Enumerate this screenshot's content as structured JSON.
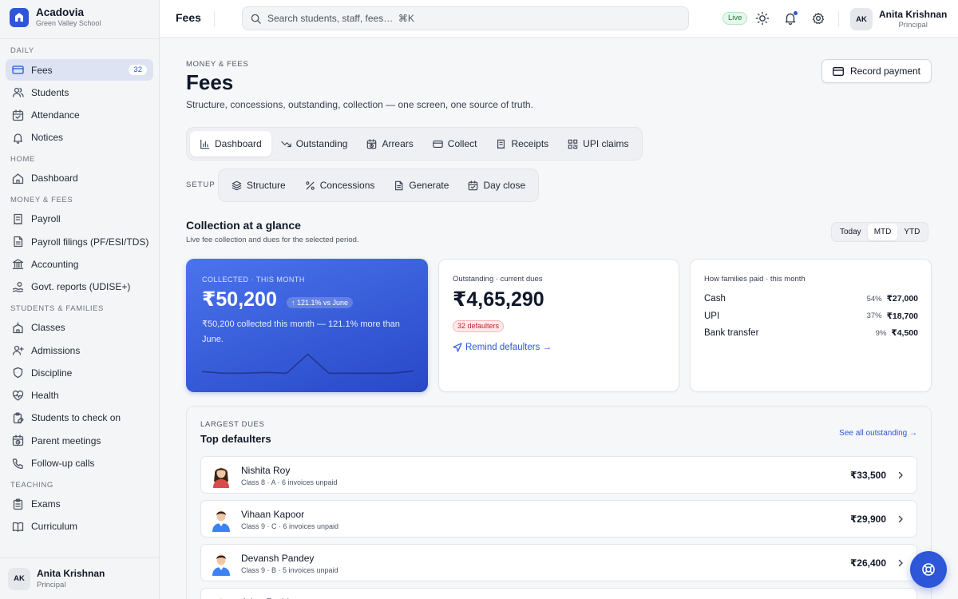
{
  "app": {
    "name": "Acadovia",
    "school": "Green Valley School"
  },
  "sidebar": {
    "sections": [
      {
        "label": "DAILY",
        "items": [
          {
            "label": "Fees",
            "badge": "32",
            "icon": "credit-card-icon",
            "active": true
          },
          {
            "label": "Students",
            "icon": "users-icon"
          },
          {
            "label": "Attendance",
            "icon": "calendar-check-icon"
          },
          {
            "label": "Notices",
            "icon": "bell-icon"
          }
        ]
      },
      {
        "label": "HOME",
        "items": [
          {
            "label": "Dashboard",
            "icon": "home-icon"
          }
        ]
      },
      {
        "label": "MONEY & FEES",
        "items": [
          {
            "label": "Payroll",
            "icon": "receipt-icon"
          },
          {
            "label": "Payroll filings (PF/ESI/TDS)",
            "icon": "file-icon"
          },
          {
            "label": "Accounting",
            "icon": "bank-icon"
          },
          {
            "label": "Govt. reports (UDISE+)",
            "icon": "hand-coins-icon"
          }
        ]
      },
      {
        "label": "STUDENTS & FAMILIES",
        "items": [
          {
            "label": "Classes",
            "icon": "school-icon"
          },
          {
            "label": "Admissions",
            "icon": "user-plus-icon"
          },
          {
            "label": "Discipline",
            "icon": "shield-icon"
          },
          {
            "label": "Health",
            "icon": "heart-pulse-icon"
          },
          {
            "label": "Students to check on",
            "icon": "clipboard-edit-icon"
          },
          {
            "label": "Parent meetings",
            "icon": "calendar-clock-icon"
          },
          {
            "label": "Follow-up calls",
            "icon": "phone-icon"
          }
        ]
      },
      {
        "label": "TEACHING",
        "items": [
          {
            "label": "Exams",
            "icon": "clipboard-list-icon"
          },
          {
            "label": "Curriculum",
            "icon": "book-open-icon"
          }
        ]
      }
    ],
    "user": {
      "initials": "AK",
      "name": "Anita Krishnan",
      "role": "Principal"
    }
  },
  "topbar": {
    "title": "Fees",
    "search_placeholder": "Search students, staff, fees…  ⌘K",
    "live": "Live",
    "user": {
      "initials": "AK",
      "name": "Anita Krishnan",
      "role": "Principal"
    }
  },
  "page": {
    "eyebrow": "MONEY & FEES",
    "title": "Fees",
    "subtitle": "Structure, concessions, outstanding, collection — one screen, one source of truth.",
    "record_button": "Record payment"
  },
  "tabs": [
    {
      "label": "Dashboard",
      "icon": "bar-chart-icon",
      "active": true
    },
    {
      "label": "Outstanding",
      "icon": "trending-down-icon"
    },
    {
      "label": "Arrears",
      "icon": "calendar-clock-icon"
    },
    {
      "label": "Collect",
      "icon": "credit-card-icon"
    },
    {
      "label": "Receipts",
      "icon": "receipt-icon"
    },
    {
      "label": "UPI claims",
      "icon": "qr-code-icon"
    }
  ],
  "setup": {
    "label": "SETUP",
    "tabs": [
      {
        "label": "Structure",
        "icon": "layers-icon"
      },
      {
        "label": "Concessions",
        "icon": "percent-icon"
      },
      {
        "label": "Generate",
        "icon": "file-text-icon"
      },
      {
        "label": "Day close",
        "icon": "calendar-check-icon"
      }
    ]
  },
  "glance": {
    "title": "Collection at a glance",
    "subtitle": "Live fee collection and dues for the selected period.",
    "ranges": [
      "Today",
      "MTD",
      "YTD"
    ],
    "active_range": "MTD"
  },
  "collected": {
    "label": "COLLECTED · THIS MONTH",
    "value": "₹50,200",
    "change": "121.1% vs June",
    "description": "₹50,200 collected this month — 121.1% more than June.",
    "sparkline": [
      0.28,
      0.22,
      0.22,
      0.25,
      0.22,
      0.9,
      0.22,
      0.22,
      0.22,
      0.22,
      0.3
    ]
  },
  "outstanding": {
    "label": "Outstanding · current dues",
    "value": "₹4,65,290",
    "defaulters": "32 defaulters",
    "action": "Remind defaulters →"
  },
  "payment_methods": {
    "label": "How families paid · this month",
    "rows": [
      {
        "name": "Cash",
        "pct": "54%",
        "amount": "₹27,000"
      },
      {
        "name": "UPI",
        "pct": "37%",
        "amount": "₹18,700"
      },
      {
        "name": "Bank transfer",
        "pct": "9%",
        "amount": "₹4,500"
      }
    ]
  },
  "defaulters": {
    "eyebrow": "LARGEST DUES",
    "title": "Top defaulters",
    "see_all": "See all outstanding →",
    "rows": [
      {
        "name": "Nishita Roy",
        "meta": "Class 8 · A  ·  6 invoices unpaid",
        "amount": "₹33,500",
        "gender": "f"
      },
      {
        "name": "Vihaan Kapoor",
        "meta": "Class 9 · C  ·  6 invoices unpaid",
        "amount": "₹29,900",
        "gender": "m"
      },
      {
        "name": "Devansh Pandey",
        "meta": "Class 9 · B  ·  5 invoices unpaid",
        "amount": "₹26,400",
        "gender": "m"
      },
      {
        "name": "Arjun Reddy",
        "meta": "",
        "amount": "",
        "gender": "m"
      }
    ]
  },
  "colors": {
    "accent": "#2d56d8",
    "danger": "#c0262d",
    "success": "#16803c"
  }
}
